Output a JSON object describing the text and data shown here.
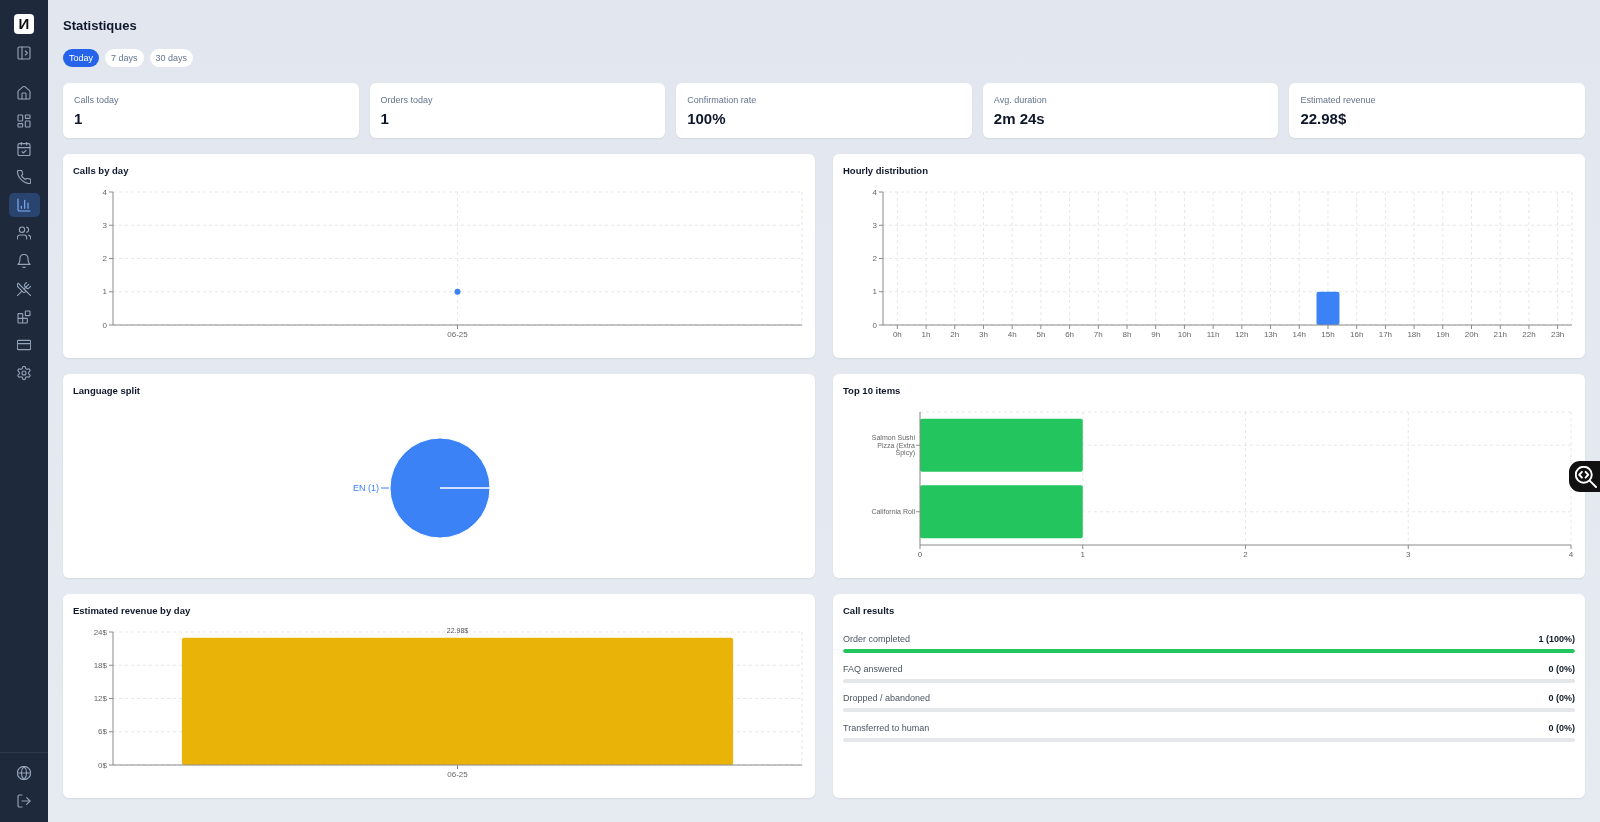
{
  "sidebar": {
    "logo": "И",
    "items": [
      {
        "selected": false
      },
      {
        "selected": false
      },
      {
        "selected": false
      },
      {
        "selected": false
      },
      {
        "selected": true
      },
      {
        "selected": false
      },
      {
        "selected": false
      },
      {
        "selected": false
      },
      {
        "selected": false
      },
      {
        "selected": false
      },
      {
        "selected": false
      }
    ]
  },
  "page": {
    "title": "Statistiques"
  },
  "period_tabs": [
    {
      "label": "Today",
      "selected": true
    },
    {
      "label": "7 days",
      "selected": false
    },
    {
      "label": "30 days",
      "selected": false
    }
  ],
  "stat_cards": [
    {
      "label": "Calls today",
      "value": "1"
    },
    {
      "label": "Orders today",
      "value": "1"
    },
    {
      "label": "Confirmation rate",
      "value": "100%"
    },
    {
      "label": "Avg. duration",
      "value": "2m 24s"
    },
    {
      "label": "Estimated revenue",
      "value": "22.98$"
    }
  ],
  "panels": [
    {
      "kind": "chart",
      "title": "Calls by day",
      "chart_data": {
        "type": "line",
        "categories": [
          "06-25"
        ],
        "series": [
          {
            "color": "#3b82f6",
            "marker": true,
            "values": [
              1
            ]
          }
        ],
        "ylim": [
          0,
          4
        ],
        "yticks": [
          0,
          1,
          2,
          3,
          4
        ],
        "grid": true
      }
    },
    {
      "kind": "chart",
      "title": "Hourly distribution",
      "chart_data": {
        "type": "bar",
        "categories": [
          "0h",
          "1h",
          "2h",
          "3h",
          "4h",
          "5h",
          "6h",
          "7h",
          "8h",
          "9h",
          "10h",
          "11h",
          "12h",
          "13h",
          "14h",
          "15h",
          "16h",
          "17h",
          "18h",
          "19h",
          "20h",
          "21h",
          "22h",
          "23h"
        ],
        "series": [
          {
            "color": "#3b82f6",
            "values": [
              0,
              0,
              0,
              0,
              0,
              0,
              0,
              0,
              0,
              0,
              0,
              0,
              0,
              0,
              0,
              1,
              0,
              0,
              0,
              0,
              0,
              0,
              0,
              0
            ]
          }
        ],
        "ylim": [
          0,
          4
        ],
        "yticks": [
          0,
          1,
          2,
          3,
          4
        ],
        "grid": true
      }
    },
    {
      "kind": "chart",
      "title": "Language split",
      "chart_data": {
        "type": "pie",
        "categories": [
          "EN (1)"
        ],
        "series": [
          {
            "color": "#3b82f6",
            "values": [
              1
            ]
          }
        ]
      }
    },
    {
      "kind": "chart",
      "title": "Top 10 items",
      "chart_data": {
        "type": "bar",
        "orientation": "horizontal",
        "categories": [
          "Salmon Sushi Pizza (Extra Spicy)",
          "California Roll"
        ],
        "series": [
          {
            "color": "#22c55e",
            "values": [
              1,
              1
            ]
          }
        ],
        "xlim": [
          0,
          4
        ],
        "xticks": [
          0,
          1,
          2,
          3,
          4
        ],
        "grid": true
      }
    },
    {
      "kind": "chart",
      "title": "Estimated revenue by day",
      "chart_data": {
        "type": "bar",
        "categories": [
          "06-25"
        ],
        "series": [
          {
            "color": "#eab308",
            "values": [
              22.98
            ]
          }
        ],
        "ylim": [
          0,
          24
        ],
        "yticks": [
          {
            "value": 0,
            "label": "0$"
          },
          {
            "value": 6,
            "label": "6$"
          },
          {
            "value": 12,
            "label": "12$"
          },
          {
            "value": 18,
            "label": "18$"
          },
          {
            "value": 24,
            "label": "24$"
          }
        ],
        "value_labels": [
          "22.98$"
        ],
        "grid": true
      }
    },
    {
      "kind": "results",
      "title": "Call results",
      "items": [
        {
          "label": "Order completed",
          "value": "1 (100%)",
          "level": 1
        },
        {
          "label": "FAQ answered",
          "value": "0 (0%)",
          "level": 0
        },
        {
          "label": "Dropped / abandoned",
          "value": "0 (0%)",
          "level": 0
        },
        {
          "label": "Transferred to human",
          "value": "0 (0%)",
          "level": 0
        }
      ]
    }
  ]
}
